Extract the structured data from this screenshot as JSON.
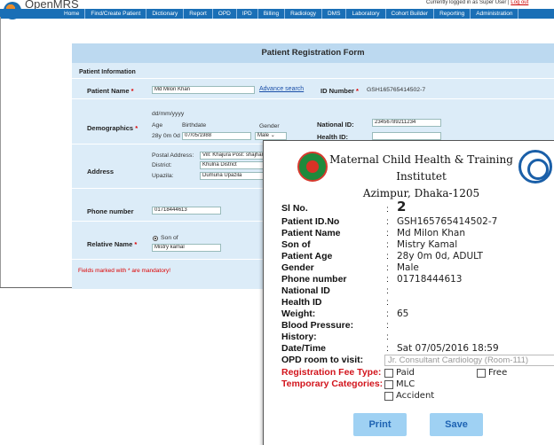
{
  "header": {
    "brand": "OpenMRS",
    "logged_in_text": "Currently logged in as Super User",
    "logout_sep": " | ",
    "logout_label": "Log out",
    "nav_items": [
      "Home",
      "Find/Create Patient",
      "Dictionary",
      "Report",
      "OPD",
      "IPD",
      "Billing",
      "Radiology",
      "DMS",
      "Laboratory",
      "Cohort Builder",
      "Reporting",
      "Administration"
    ],
    "accent_color": "#1a6fb6"
  },
  "form": {
    "title": "Patient Registration Form",
    "section_info": "Patient Information",
    "patient_name_label": "Patient Name",
    "patient_name_value": "Md Milon Khan",
    "advance_search": "Advance search",
    "id_number_label": "ID Number",
    "id_number_value": "GSH165765414502-7",
    "demographics_label": "Demographics",
    "date_format": "dd/mm/yyyy",
    "age_label": "Age",
    "birthdate_label": "Birthdate",
    "gender_label": "Gender",
    "age_value": "28y 0m 0d",
    "birthdate_value": "07/05/1988",
    "gender_value": "Male",
    "national_id_label": "National ID:",
    "national_id_value": "23456789211234",
    "health_id_label": "Health ID:",
    "address_label": "Address",
    "postal_address_label": "Postal Address:",
    "postal_address_value": "Vill: Khajura Post: shajhanpur",
    "district_label": "District:",
    "district_value": "Khulna District",
    "upazila_label": "Upazila:",
    "upazila_value": "Dumuria Upazila",
    "phone_label": "Phone number",
    "phone_value": "01718444613",
    "relative_label": "Relative Name",
    "relative_type": "Son of",
    "relative_value": "Mistry kamal",
    "mandatory_note": "Fields marked with * are mandatory!",
    "required_mark": "*"
  },
  "slip": {
    "title_line1": "Maternal Child Health & Training Institutet",
    "title_line2": "Azimpur, Dhaka-1205",
    "colon": ":",
    "fields": [
      {
        "label": "Sl No.",
        "value": "2"
      },
      {
        "label": "Patient ID.No",
        "value": "GSH165765414502-7"
      },
      {
        "label": "Patient Name",
        "value": "Md Milon Khan"
      },
      {
        "label": "Son of",
        "value": "Mistry Kamal"
      },
      {
        "label": "Patient Age",
        "value": "28y 0m 0d, ADULT"
      },
      {
        "label": "Gender",
        "value": "Male"
      },
      {
        "label": "Phone number",
        "value": "01718444613"
      },
      {
        "label": "National ID",
        "value": ""
      },
      {
        "label": "Health ID",
        "value": ""
      },
      {
        "label": "Weight:",
        "value": "65"
      },
      {
        "label": "Blood Pressure:",
        "value": ""
      },
      {
        "label": "History:",
        "value": ""
      },
      {
        "label": "Date/Time",
        "value": "Sat 07/05/2016 18:59"
      }
    ],
    "opd_label": "OPD room to visit:",
    "opd_value": "Jr. Consultant Cardiology (Room-111)",
    "reg_fee_label": "Registration Fee Type:",
    "paid_label": "Paid",
    "free_label": "Free",
    "temp_cat_label": "Temporary Categories:",
    "mlc_label": "MLC",
    "accident_label": "Accident",
    "print_label": "Print",
    "save_label": "Save",
    "button_color": "#9fd1f3"
  }
}
